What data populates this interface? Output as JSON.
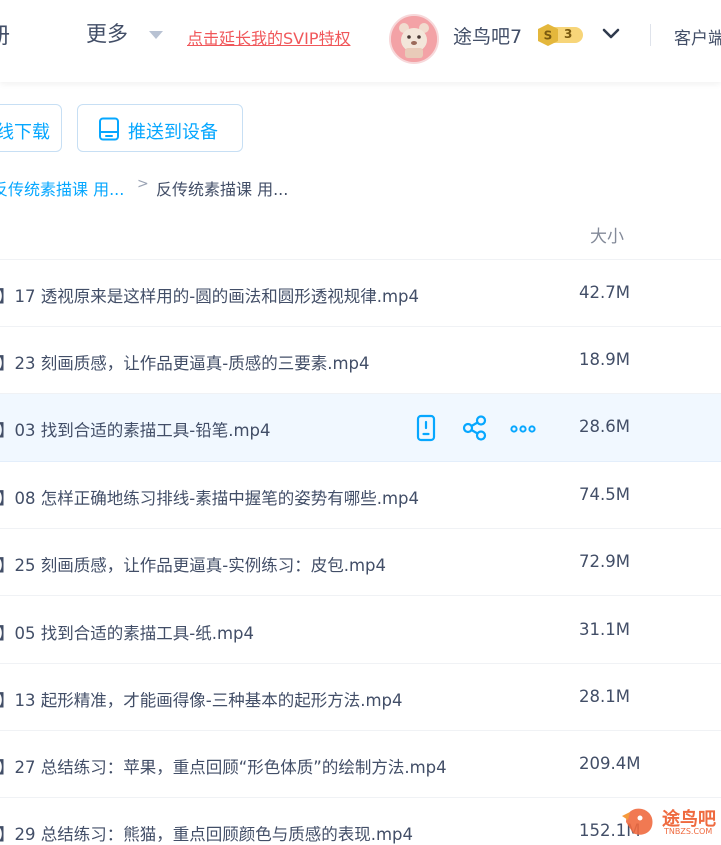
{
  "header": {
    "nav_cut_label": "册",
    "nav_more_label": "更多",
    "svip_link": "点击延长我的SVIP特权",
    "username": "途鸟吧7",
    "level_badge": "3",
    "client_link": "客户端"
  },
  "toolbar": {
    "offline_download_label": "线下载",
    "push_to_device_label": "推送到设备"
  },
  "breadcrumb": {
    "parent": "反传统素描课 用...",
    "separator": ">",
    "current": "反传统素描课 用..."
  },
  "list": {
    "size_header": "大小",
    "rows": [
      {
        "name": "】17 透视原来是这样用的-圆的画法和圆形透视规律.mp4",
        "size": "42.7M"
      },
      {
        "name": "】23 刻画质感，让作品更逼真-质感的三要素.mp4",
        "size": "18.9M"
      },
      {
        "name": "】03 找到合适的素描工具-铅笔.mp4",
        "size": "28.6M"
      },
      {
        "name": "】08 怎样正确地练习排线-素描中握笔的姿势有哪些.mp4",
        "size": "74.5M"
      },
      {
        "name": "】25 刻画质感，让作品更逼真-实例练习：皮包.mp4",
        "size": "72.9M"
      },
      {
        "name": "】05 找到合适的素描工具-纸.mp4",
        "size": "31.1M"
      },
      {
        "name": "】13 起形精准，才能画得像-三种基本的起形方法.mp4",
        "size": "28.1M"
      },
      {
        "name": "】27 总结练习：苹果，重点回顾“形色体质”的绘制方法.mp4",
        "size": "209.4M"
      },
      {
        "name": "】29 总结练习：熊猫，重点回顾颜色与质感的表现.mp4",
        "size": "152.1M"
      }
    ],
    "row_icons": [
      "phone-push-icon",
      "share-icon",
      "more-icon"
    ]
  },
  "watermark": {
    "text": "途鸟吧",
    "sub": "TNBZS.COM"
  },
  "colors": {
    "accent": "#06a7ff",
    "svip_red": "#f0575a",
    "text": "#424e67",
    "hover_row": "#f1f8ff"
  }
}
